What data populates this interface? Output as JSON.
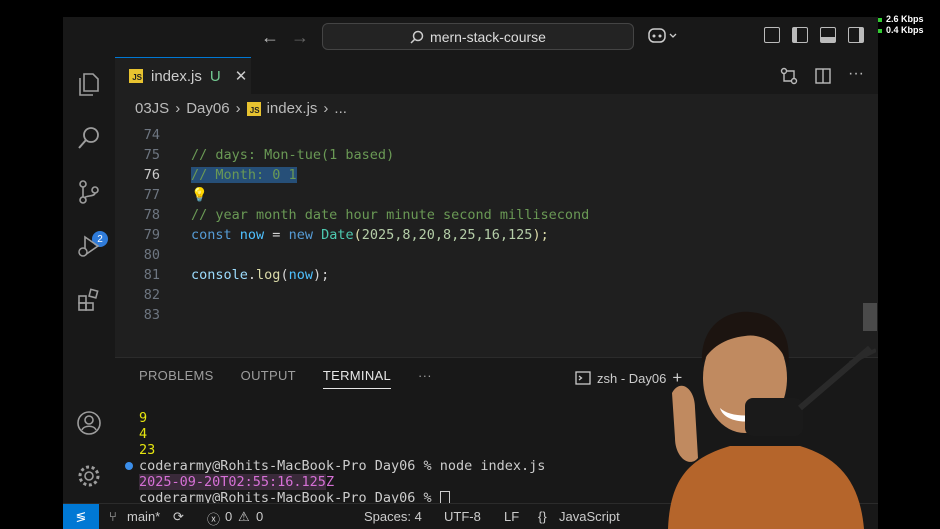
{
  "network": {
    "up": "2.6 Kbps",
    "down": "0.4 Kbps"
  },
  "titlebar": {
    "search_text": "mern-stack-course"
  },
  "activity": {
    "scm_badge": "2"
  },
  "tab": {
    "filename": "index.js",
    "status": "U",
    "icon_text": "JS"
  },
  "breadcrumb": {
    "parts": [
      "03JS",
      "Day06",
      "index.js",
      "..."
    ]
  },
  "code": {
    "lines": [
      {
        "num": "74"
      },
      {
        "num": "75"
      },
      {
        "num": "76"
      },
      {
        "num": "77"
      },
      {
        "num": "78"
      },
      {
        "num": "79"
      },
      {
        "num": "80"
      },
      {
        "num": "81"
      },
      {
        "num": "82"
      },
      {
        "num": "83"
      }
    ],
    "l75": "// days: Mon-tue(1 based)",
    "l76": "// Month: 0 1",
    "l78": "// year month date hour minute second millisecond",
    "l79": {
      "const": "const",
      "var": "now",
      "eq": " = ",
      "new": "new",
      "cls": "Date",
      "args": "2025,8,20,8,25,16,125",
      "open": "(",
      "close": ");"
    },
    "l81": {
      "obj": "console",
      "dot": ".",
      "fn": "log",
      "open": "(",
      "arg": "now",
      "close": ");"
    }
  },
  "panel": {
    "tabs": [
      "PROBLEMS",
      "OUTPUT",
      "TERMINAL"
    ],
    "more": "···",
    "terminal_title": "zsh - Day06",
    "add": "+"
  },
  "terminal": {
    "out1": "9",
    "out2": "4",
    "out3": "23",
    "cmd_line": "coderarmy@Rohits-MacBook-Pro Day06 % node index.js",
    "timestamp": "2025-09-20T02:55:16.125",
    "timestamp_z": "Z",
    "prompt_line": "coderarmy@Rohits-MacBook-Pro Day06 % "
  },
  "status": {
    "branch": "main*",
    "errors": "0",
    "warnings": "0",
    "spaces": "Spaces: 4",
    "encoding": "UTF-8",
    "eol": "LF",
    "language": "JavaScript"
  },
  "colors": {
    "accent": "#0078d4",
    "badge": "#2f7bd9",
    "js_icon": "#e8c330"
  }
}
